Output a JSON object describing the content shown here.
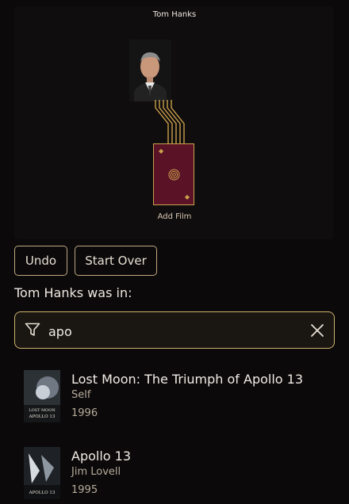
{
  "board": {
    "actor_name": "Tom Hanks",
    "add_film_label": "Add Film"
  },
  "controls": {
    "undo_label": "Undo",
    "start_over_label": "Start Over"
  },
  "section_title": "Tom Hanks was in:",
  "search": {
    "value": "apo",
    "filter_icon": "filter-icon",
    "clear_icon": "close-icon"
  },
  "results": [
    {
      "title": "Lost Moon: The Triumph of Apollo 13",
      "role": "Self",
      "year": "1996",
      "poster_text": "LOST MOON\nAPOLLO 13"
    },
    {
      "title": "Apollo 13",
      "role": "Jim Lovell",
      "year": "1995",
      "poster_text": "APOLLO 13"
    }
  ],
  "colors": {
    "accent_gold": "#c9a14b",
    "card_maroon": "#5a1227",
    "background": "#0b090a"
  }
}
